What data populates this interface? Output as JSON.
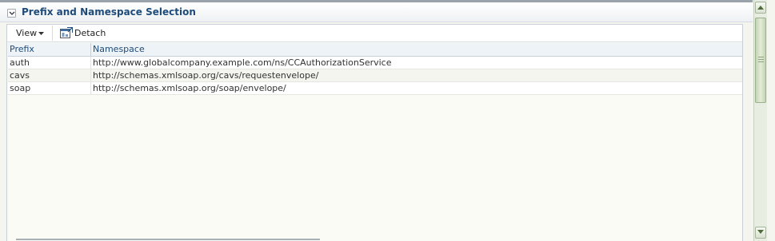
{
  "section": {
    "title": "Prefix and Namespace Selection"
  },
  "toolbar": {
    "view_label": "View",
    "detach_label": "Detach"
  },
  "table": {
    "columns": [
      "Prefix",
      "Namespace"
    ],
    "rows": [
      {
        "prefix": "auth",
        "namespace": "http://www.globalcompany.example.com/ns/CCAuthorizationService"
      },
      {
        "prefix": "cavs",
        "namespace": "http://schemas.xmlsoap.org/cavs/requestenvelope/"
      },
      {
        "prefix": "soap",
        "namespace": "http://schemas.xmlsoap.org/soap/envelope/"
      }
    ]
  },
  "icons": {
    "collapse": "chevron-down-icon",
    "view_menu": "caret-down-icon",
    "detach": "detach-icon",
    "scroll_up": "arrow-up-icon",
    "scroll_down": "arrow-down-icon"
  },
  "colors": {
    "title": "#1e4b7a",
    "header_text": "#1d4d7a",
    "scroll_thumb": "#c4d4b3"
  }
}
